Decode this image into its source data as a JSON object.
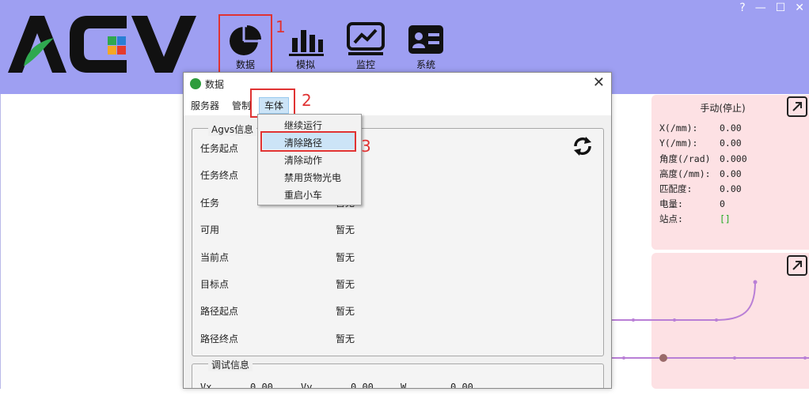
{
  "window": {
    "controls": [
      "?",
      "—",
      "☐",
      "✕"
    ]
  },
  "logo": {
    "text": "AGV",
    "accent_colors": [
      "#2fa84f",
      "#e53b2c",
      "#f5a623",
      "#2a7fd4"
    ]
  },
  "nav": [
    {
      "label": "数据",
      "icon": "pie-chart-icon"
    },
    {
      "label": "模拟",
      "icon": "bar-chart-icon"
    },
    {
      "label": "监控",
      "icon": "monitor-icon"
    },
    {
      "label": "系统",
      "icon": "id-card-icon"
    }
  ],
  "annotations": [
    "1",
    "2",
    "3"
  ],
  "dialog": {
    "title": "数据",
    "close": "✕",
    "menus": [
      "服务器",
      "管制",
      "车体"
    ],
    "agv_group_title": "Agvs信息",
    "agv_rows": [
      {
        "label": "任务起点",
        "value": ""
      },
      {
        "label": "任务终点",
        "value": ""
      },
      {
        "label": "任务",
        "value": "暂无"
      },
      {
        "label": "可用",
        "value": "暂无"
      },
      {
        "label": "当前点",
        "value": "暂无"
      },
      {
        "label": "目标点",
        "value": "暂无"
      },
      {
        "label": "路径起点",
        "value": "暂无"
      },
      {
        "label": "路径终点",
        "value": "暂无"
      }
    ],
    "debug_group_title": "调试信息",
    "debug_row": [
      {
        "label": "Vx",
        "value": "0.00"
      },
      {
        "label": "Vy",
        "value": "0.00"
      },
      {
        "label": "W",
        "value": "0.00"
      }
    ]
  },
  "dropdown": {
    "items": [
      "继续运行",
      "清除路径",
      "清除动作",
      "禁用货物光电",
      "重启小车"
    ],
    "highlighted_index": 1
  },
  "info_panel": {
    "title": "手动(停止)",
    "rows": [
      {
        "label": "X(/mm):",
        "value": "0.00"
      },
      {
        "label": "Y(/mm):",
        "value": "0.00"
      },
      {
        "label": "角度(/rad)",
        "value": "0.000"
      },
      {
        "label": "高度(/mm):",
        "value": "0.00"
      },
      {
        "label": "匹配度:",
        "value": "0.00"
      },
      {
        "label": "电量:",
        "value": "0"
      },
      {
        "label": "站点:",
        "value": "[]"
      }
    ]
  },
  "colors": {
    "header_bg": "#9e9ff2",
    "info_panel_bg": "#fde1e4",
    "annotation_red": "#e03333",
    "path_purple": "#b97fd6",
    "station_green": "#22aa22"
  }
}
